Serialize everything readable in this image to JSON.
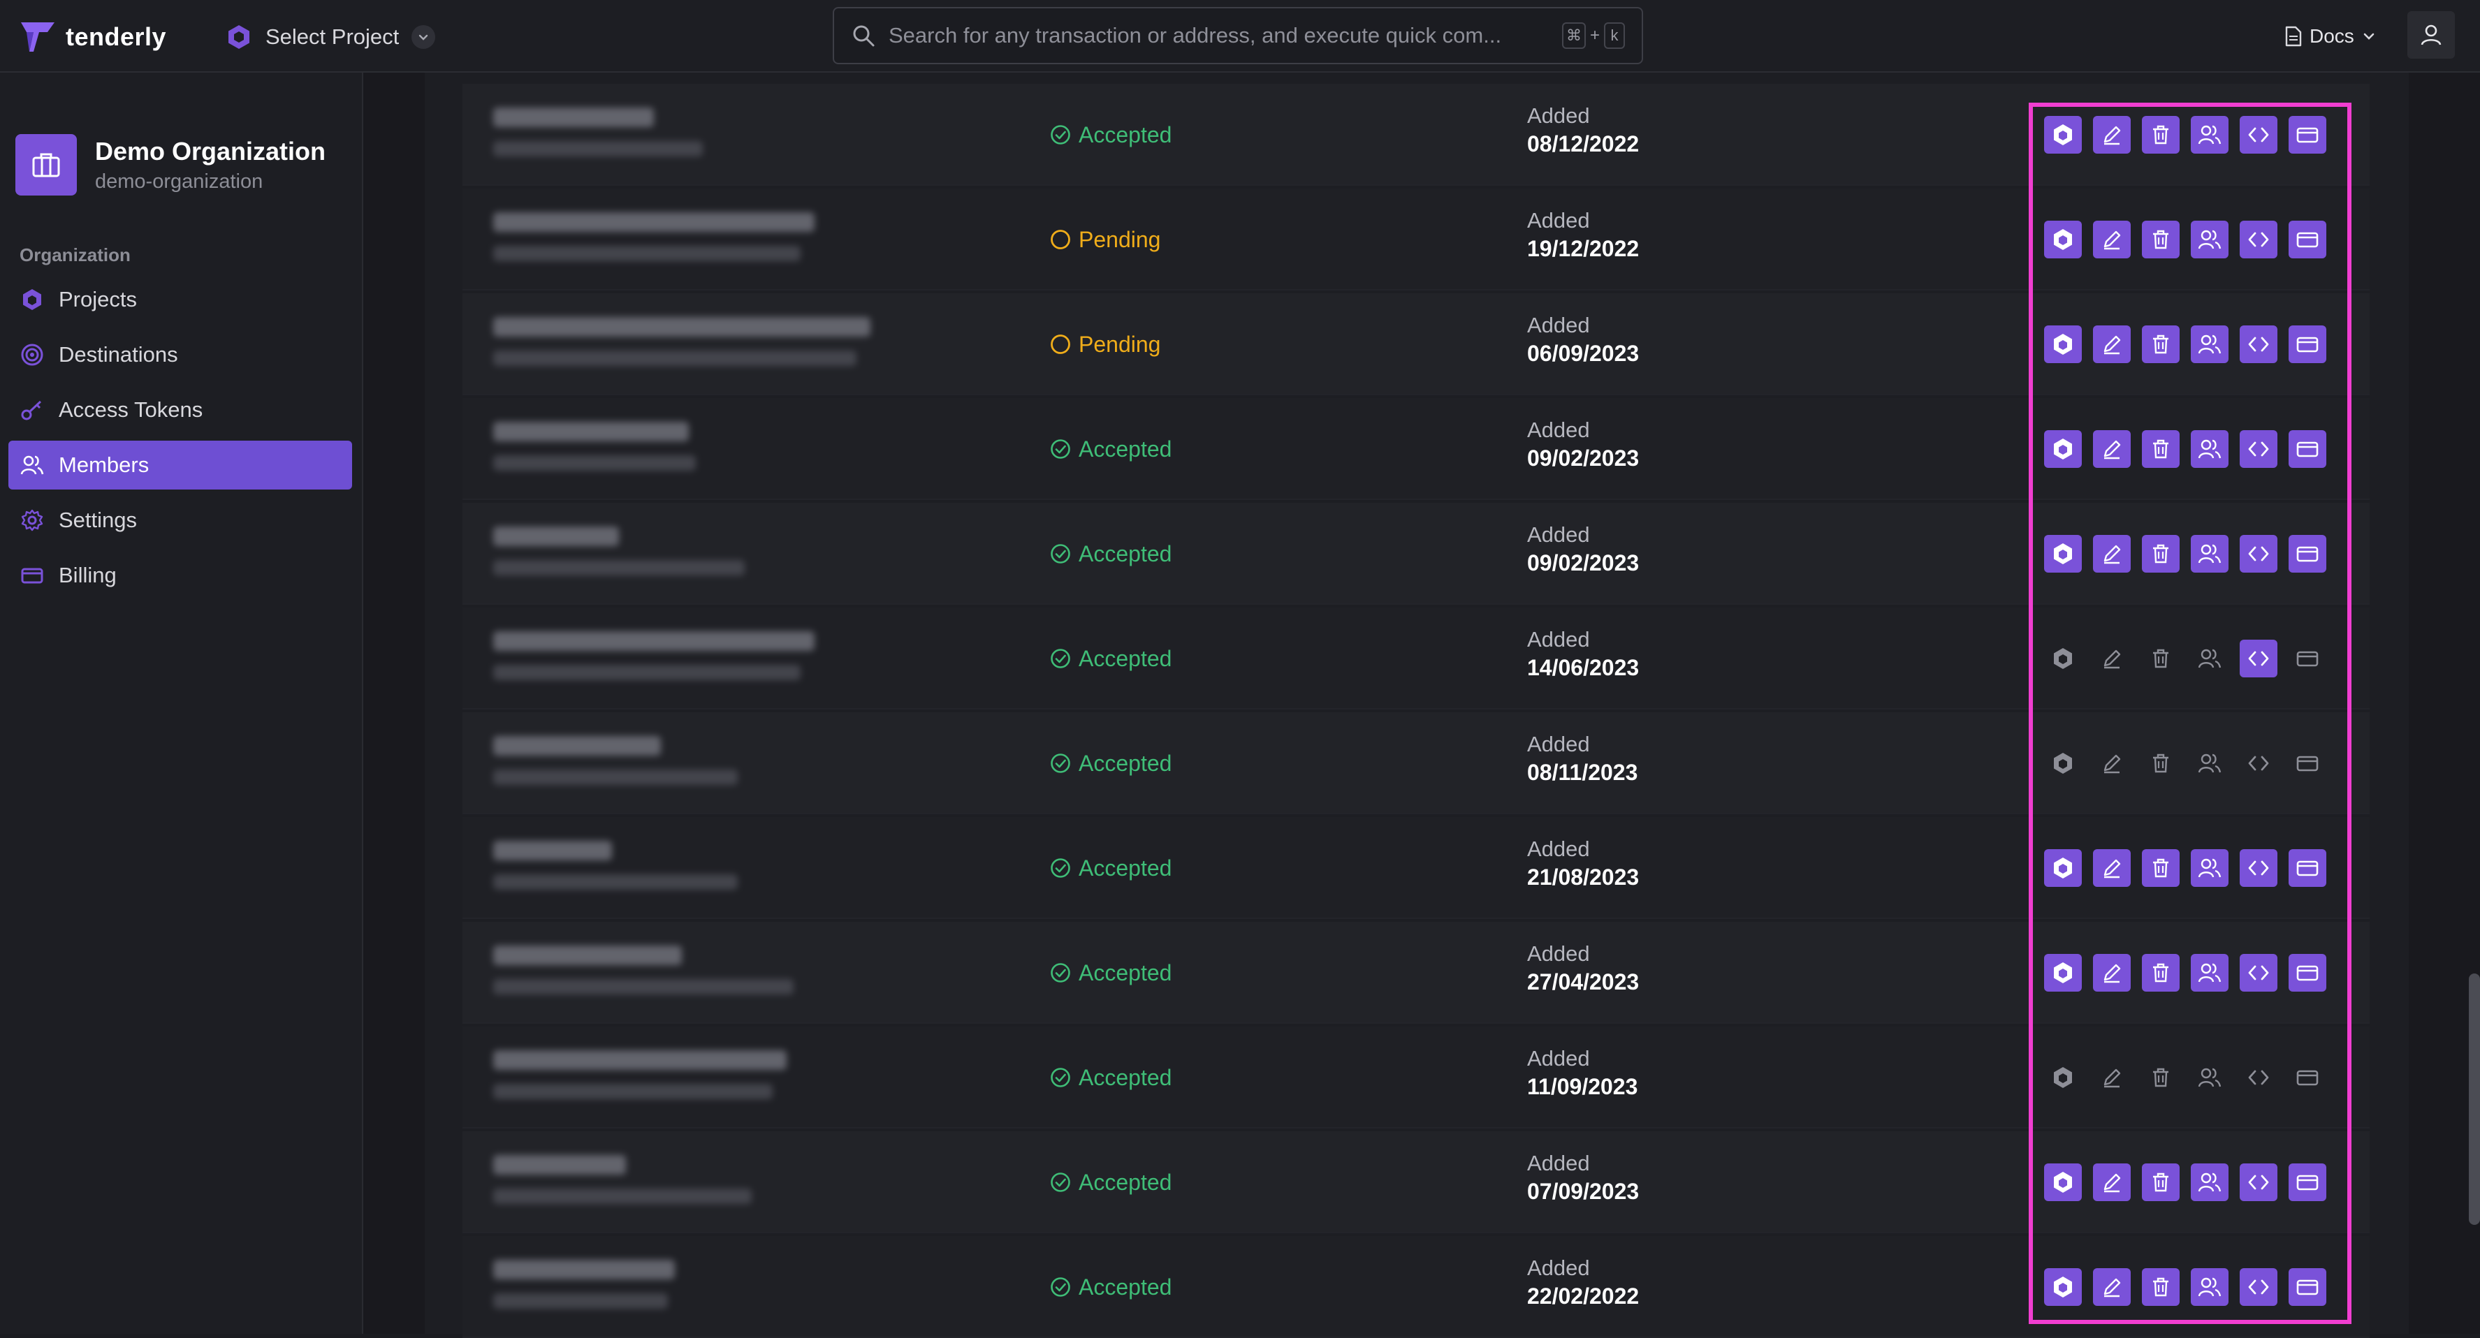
{
  "brand": {
    "name": "tenderly"
  },
  "header": {
    "project_select_label": "Select Project",
    "search_placeholder": "Search for any transaction or address, and execute quick com...",
    "shortcut": [
      "⌘",
      "+",
      "k"
    ],
    "docs_label": "Docs"
  },
  "sidebar": {
    "org_name": "Demo Organization",
    "org_slug": "demo-organization",
    "section_label": "Organization",
    "items": [
      {
        "label": "Projects",
        "icon": "hexagon-icon"
      },
      {
        "label": "Destinations",
        "icon": "target-icon"
      },
      {
        "label": "Access Tokens",
        "icon": "key-icon"
      },
      {
        "label": "Members",
        "icon": "users-icon",
        "active": true
      },
      {
        "label": "Settings",
        "icon": "gear-icon"
      },
      {
        "label": "Billing",
        "icon": "card-icon"
      }
    ]
  },
  "members": {
    "added_label": "Added",
    "rows": [
      {
        "status": "Accepted",
        "date": "08/12/2022",
        "perms": [
          true,
          true,
          true,
          true,
          true,
          true
        ]
      },
      {
        "status": "Pending",
        "date": "19/12/2022",
        "perms": [
          true,
          true,
          true,
          true,
          true,
          true
        ]
      },
      {
        "status": "Pending",
        "date": "06/09/2023",
        "perms": [
          true,
          true,
          true,
          true,
          true,
          true
        ]
      },
      {
        "status": "Accepted",
        "date": "09/02/2023",
        "perms": [
          true,
          true,
          true,
          true,
          true,
          true
        ]
      },
      {
        "status": "Accepted",
        "date": "09/02/2023",
        "perms": [
          true,
          true,
          true,
          true,
          true,
          true
        ]
      },
      {
        "status": "Accepted",
        "date": "14/06/2023",
        "perms": [
          false,
          false,
          false,
          false,
          true,
          false
        ]
      },
      {
        "status": "Accepted",
        "date": "08/11/2023",
        "perms": [
          false,
          false,
          false,
          false,
          false,
          false
        ]
      },
      {
        "status": "Accepted",
        "date": "21/08/2023",
        "perms": [
          true,
          true,
          true,
          true,
          true,
          true
        ]
      },
      {
        "status": "Accepted",
        "date": "27/04/2023",
        "perms": [
          true,
          true,
          true,
          true,
          true,
          true
        ]
      },
      {
        "status": "Accepted",
        "date": "11/09/2023",
        "perms": [
          false,
          false,
          false,
          false,
          false,
          false
        ]
      },
      {
        "status": "Accepted",
        "date": "07/09/2023",
        "perms": [
          true,
          true,
          true,
          true,
          true,
          true
        ]
      },
      {
        "status": "Accepted",
        "date": "22/02/2022",
        "perms": [
          true,
          true,
          true,
          true,
          true,
          true
        ]
      }
    ],
    "permission_icons": [
      "hexagon-icon",
      "pencil-icon",
      "trash-icon",
      "users-icon",
      "code-icon",
      "card-icon"
    ]
  },
  "colors": {
    "accent": "#7a52d9",
    "accepted": "#3fbd77",
    "pending": "#f0ad1a",
    "highlight": "#f13ed1"
  }
}
